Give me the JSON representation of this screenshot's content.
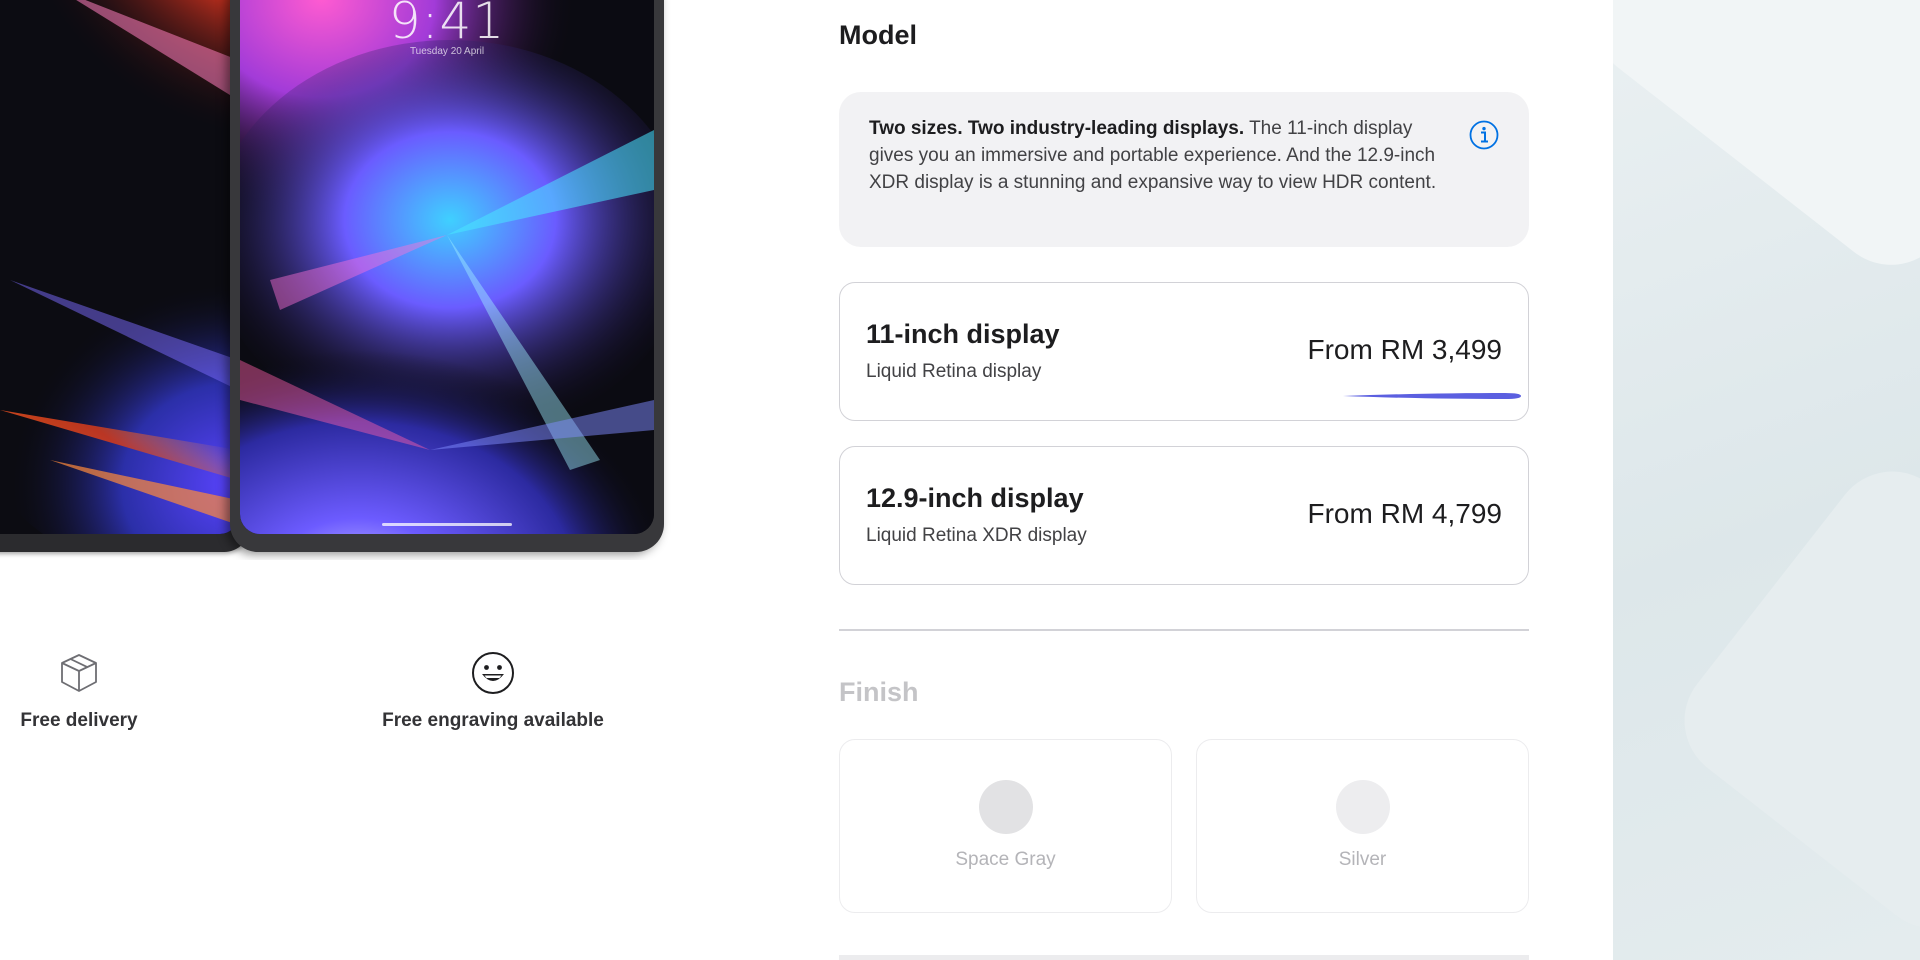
{
  "product": {
    "lock_time": "9:41",
    "lock_date": "Tuesday 20 April",
    "perks": [
      {
        "icon": "box-icon",
        "label": "Free delivery"
      },
      {
        "icon": "smiley-icon",
        "label": "Free engraving available"
      }
    ]
  },
  "model": {
    "title": "Model",
    "info_bold": "Two sizes. Two industry-leading displays.",
    "info_text": " The 11-inch display gives you an immersive and portable experience. And the 12.9-inch XDR display is a stunning and expansive way to view HDR content.",
    "info_icon": "info-icon",
    "options": [
      {
        "name": "11-inch display",
        "subtitle": "Liquid Retina display",
        "price": "From RM 3,499"
      },
      {
        "name": "12.9-inch display",
        "subtitle": "Liquid Retina XDR display",
        "price": "From RM 4,799"
      }
    ]
  },
  "finish": {
    "title": "Finish",
    "options": [
      {
        "name": "Space Gray",
        "color": "#e2e2e4"
      },
      {
        "name": "Silver",
        "color": "#ededef"
      }
    ]
  },
  "colors": {
    "accent": "#0071e3",
    "scribble": "#5b5fe0"
  }
}
